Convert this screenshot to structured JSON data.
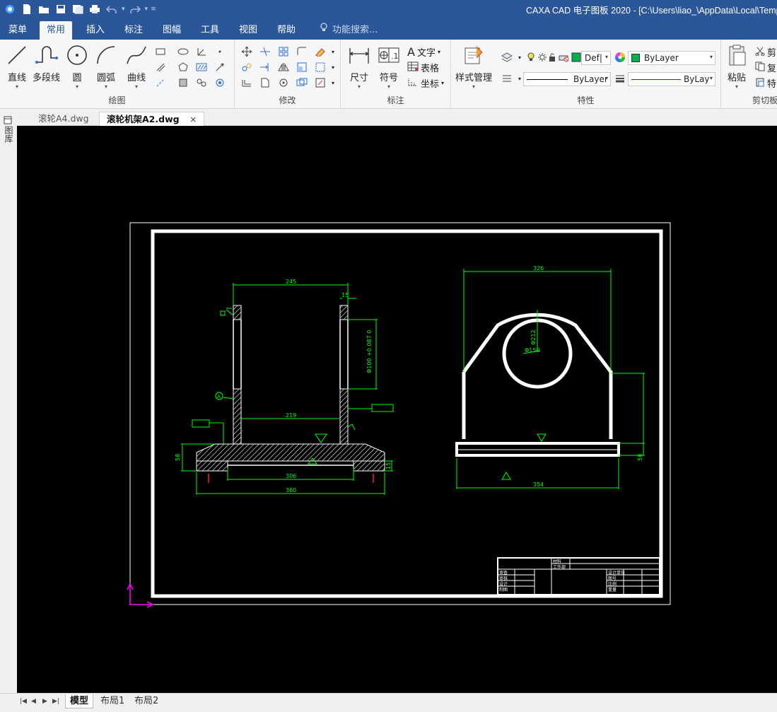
{
  "titlebar": {
    "title": "CAXA CAD 电子图板 2020 - [C:\\Users\\liao_\\AppData\\Local\\Temp\\"
  },
  "ribbon_tabs": [
    "菜单",
    "常用",
    "插入",
    "标注",
    "图幅",
    "工具",
    "视图",
    "帮助"
  ],
  "active_tab": "常用",
  "search_hint": "功能搜索...",
  "ribbon": {
    "draw": {
      "group_label": "绘图",
      "buttons": {
        "line": "直线",
        "polyline": "多段线",
        "circle": "圆",
        "arc": "圆弧",
        "curve": "曲线"
      }
    },
    "modify": {
      "group_label": "修改"
    },
    "annotate": {
      "group_label": "标注",
      "dimension": "尺寸",
      "symbol": "符号",
      "text": "文字",
      "table": "表格",
      "coordinate": "坐标"
    },
    "properties": {
      "group_label": "特性",
      "style_manager": "样式管理",
      "layer_value": "Def|",
      "color_value": "ByLayer",
      "linetype_value": "ByLayer",
      "lineweight_value": "ByLay"
    },
    "clipboard": {
      "group_label": "剪切板",
      "paste": "粘贴",
      "cut": "剪",
      "copy": "复",
      "special": "特"
    }
  },
  "doc_tabs": [
    {
      "label": "滚轮A4.dwg",
      "active": false
    },
    {
      "label": "滚轮机架A2.dwg",
      "active": true
    }
  ],
  "doc_tab_close": "×",
  "side_panel_label": "图库",
  "drawing": {
    "front_view": {
      "dims": [
        "245",
        "15",
        "Φ100 +0.087 0",
        "219",
        "306",
        "360",
        "58",
        "15"
      ],
      "datum": "A"
    },
    "side_view": {
      "dims": [
        "326",
        "Φ212",
        "Φ150",
        "58",
        "354"
      ]
    },
    "title_block": {
      "left_rows": [
        "审查",
        "审核",
        "设计",
        "制图"
      ],
      "right_rows": [
        "设计单位",
        "图号",
        "比例",
        "重量"
      ],
      "top_labels": [
        "材料",
        "工作部"
      ]
    }
  },
  "bottom_tabs": [
    "模型",
    "布局1",
    "布局2"
  ],
  "active_bottom_tab": "模型",
  "colors": {
    "title_bar": "#2b579a",
    "canvas_bg": "#000000",
    "drawing_line": "#ffffff",
    "dim_line": "#00ff00",
    "axis_ucs": "#ff00ff",
    "layer_swatch": "#00b050"
  }
}
